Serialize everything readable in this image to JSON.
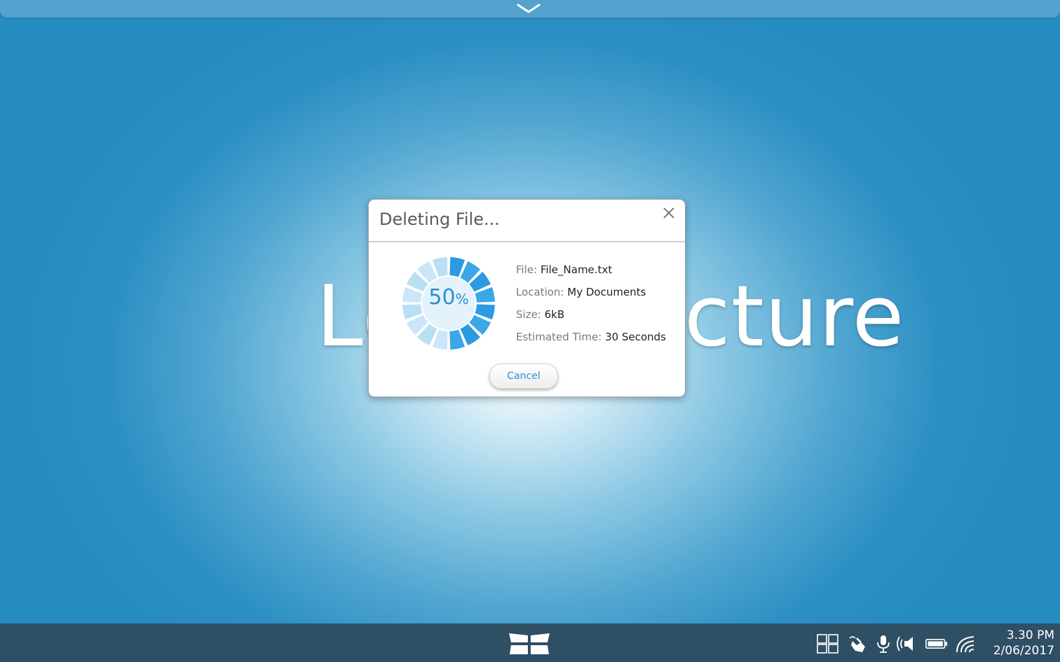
{
  "background_text": "Lorem Picture",
  "dialog": {
    "title": "Deleting File...",
    "progress": {
      "percent": 50,
      "value_label": "50",
      "unit_label": "%",
      "segments_total": 16,
      "segments_complete": 8,
      "complete_color": "#2a9be0",
      "remaining_color": "#cbe7f7"
    },
    "details": [
      {
        "label": "File:",
        "value": "File_Name.txt"
      },
      {
        "label": "Location:",
        "value": "My Documents"
      },
      {
        "label": "Size:",
        "value": "6kB"
      },
      {
        "label": "Estimated Time:",
        "value": "30 Seconds"
      }
    ],
    "cancel_label": "Cancel"
  },
  "top_bar": {
    "icon": "chevron-down-icon"
  },
  "taskbar": {
    "start_icon": "start-menu-icon",
    "tray_icons": [
      "windows-grid-icon",
      "touch-gesture-icon",
      "microphone-icon",
      "speaker-icon",
      "battery-icon",
      "wifi-icon"
    ],
    "clock": {
      "time": "3.30 PM",
      "date": "2/06/2017"
    }
  },
  "colors": {
    "accent": "#2a8fd2",
    "taskbar_bg": "#2e4f64",
    "background_edge": "#268bbf"
  }
}
